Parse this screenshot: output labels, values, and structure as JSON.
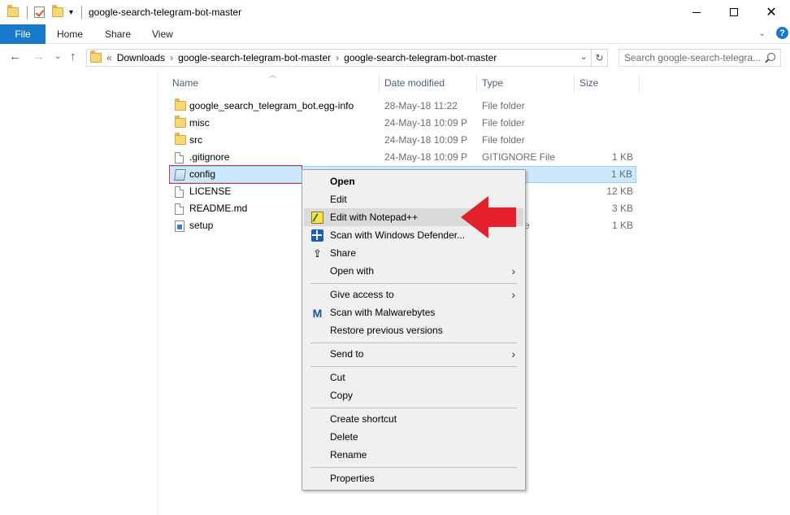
{
  "window": {
    "title": "google-search-telegram-bot-master"
  },
  "ribbon": {
    "tabs": [
      "File",
      "Home",
      "Share",
      "View"
    ]
  },
  "address": {
    "overflow": "«",
    "crumbs": [
      "Downloads",
      "google-search-telegram-bot-master",
      "google-search-telegram-bot-master"
    ],
    "search_placeholder": "Search google-search-telegra..."
  },
  "columns": {
    "name": "Name",
    "date": "Date modified",
    "type": "Type",
    "size": "Size"
  },
  "files": [
    {
      "name": "google_search_telegram_bot.egg-info",
      "date": "28-May-18 11:22",
      "type": "File folder",
      "size": "",
      "icon": "folder-icon"
    },
    {
      "name": "misc",
      "date": "24-May-18 10:09 P",
      "type": "File folder",
      "size": "",
      "icon": "folder-icon"
    },
    {
      "name": "src",
      "date": "24-May-18 10:09 P",
      "type": "File folder",
      "size": "",
      "icon": "folder-icon"
    },
    {
      "name": ".gitignore",
      "date": "24-May-18 10:09 P",
      "type": "GITIGNORE File",
      "size": "1 KB",
      "icon": "file-icon"
    },
    {
      "name": "config",
      "date": "",
      "type": "",
      "size": "1 KB",
      "icon": "config-icon"
    },
    {
      "name": "LICENSE",
      "date": "",
      "type": "",
      "size": "12 KB",
      "icon": "file-icon"
    },
    {
      "name": "README.md",
      "date": "",
      "type": "",
      "size": "3 KB",
      "icon": "file-icon"
    },
    {
      "name": "setup",
      "date": "",
      "type": "e",
      "size": "1 KB",
      "icon": "python-icon"
    }
  ],
  "context_menu": {
    "open": "Open",
    "edit": "Edit",
    "edit_notepad": "Edit with Notepad++",
    "scan_defender": "Scan with Windows Defender...",
    "share": "Share",
    "open_with": "Open with",
    "give_access": "Give access to",
    "scan_malwarebytes": "Scan with Malwarebytes",
    "restore": "Restore previous versions",
    "send_to": "Send to",
    "cut": "Cut",
    "copy": "Copy",
    "create_shortcut": "Create shortcut",
    "delete": "Delete",
    "rename": "Rename",
    "properties": "Properties"
  },
  "colors": {
    "accent": "#1979ca",
    "selection": "#cce8ff",
    "annotation_red": "#e3202b"
  }
}
